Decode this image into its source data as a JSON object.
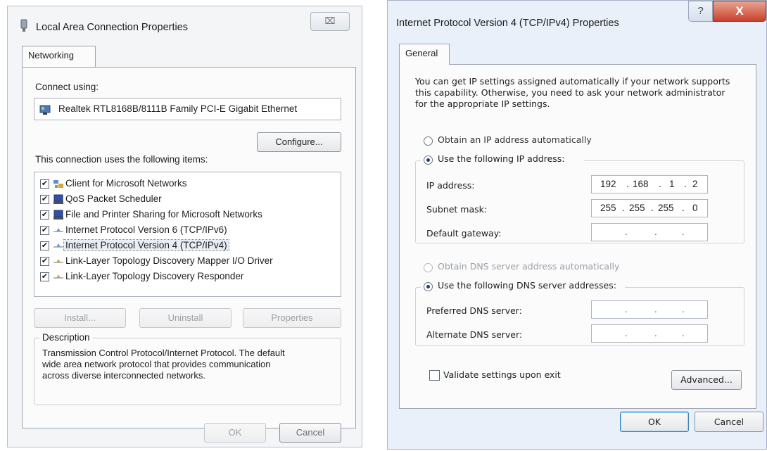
{
  "left_dialog": {
    "title": "Local Area Connection Properties",
    "close_symbol": "⌧",
    "tab": "Networking",
    "connect_using_label": "Connect using:",
    "adapter": "Realtek RTL8168B/8111B Family PCI-E Gigabit Ethernet",
    "configure_button": "Configure...",
    "items_label": "This connection uses the following items:",
    "items": [
      {
        "label": "Client for Microsoft Networks",
        "checked": true,
        "icon": "network-client-icon"
      },
      {
        "label": "QoS Packet Scheduler",
        "checked": true,
        "icon": "network-service-icon"
      },
      {
        "label": "File and Printer Sharing for Microsoft Networks",
        "checked": true,
        "icon": "network-service-icon"
      },
      {
        "label": "Internet Protocol Version 6 (TCP/IPv6)",
        "checked": true,
        "icon": "protocol-icon"
      },
      {
        "label": "Internet Protocol Version 4 (TCP/IPv4)",
        "checked": true,
        "icon": "protocol-icon",
        "selected": true
      },
      {
        "label": "Link-Layer Topology Discovery Mapper I/O Driver",
        "checked": true,
        "icon": "protocol-icon"
      },
      {
        "label": "Link-Layer Topology Discovery Responder",
        "checked": true,
        "icon": "protocol-icon"
      }
    ],
    "install_button": "Install...",
    "uninstall_button": "Uninstall",
    "properties_button": "Properties",
    "description_label": "Description",
    "description_lines": [
      "Transmission Control Protocol/Internet Protocol. The default",
      "wide area network protocol that provides communication",
      "across diverse interconnected networks."
    ],
    "ok_button": "OK",
    "cancel_button": "Cancel"
  },
  "right_dialog": {
    "title": "Internet Protocol Version 4 (TCP/IPv4) Properties",
    "help_symbol": "?",
    "close_symbol": "X",
    "tab": "General",
    "intro_lines": [
      "You can get IP settings assigned automatically if your network supports",
      "this capability. Otherwise, you need to ask your network administrator",
      "for the appropriate IP settings."
    ],
    "radio_auto_ip": "Obtain an IP address automatically",
    "radio_manual_ip": "Use the following IP address:",
    "ip_address_label": "IP address:",
    "ip_address": [
      "192",
      "168",
      "1",
      "2"
    ],
    "subnet_label": "Subnet mask:",
    "subnet": [
      "255",
      "255",
      "255",
      "0"
    ],
    "gateway_label": "Default gateway:",
    "dot": ".",
    "radio_auto_dns": "Obtain DNS server address automatically",
    "radio_manual_dns": "Use the following DNS server addresses:",
    "preferred_dns_label": "Preferred DNS server:",
    "alternate_dns_label": "Alternate DNS server:",
    "validate_label": "Validate settings upon exit",
    "advanced_button": "Advanced...",
    "ok_button": "OK",
    "cancel_button": "Cancel"
  },
  "colors": {
    "selection_radio": "#1f3f75",
    "close_red": "#c9402a"
  }
}
